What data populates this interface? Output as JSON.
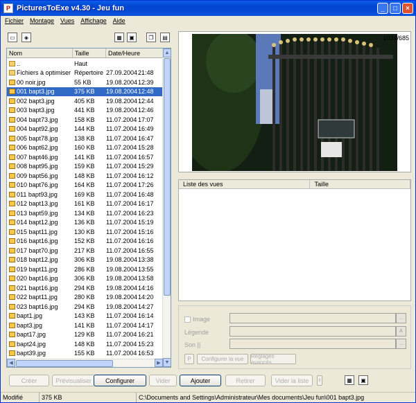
{
  "window": {
    "title": "PicturesToExe v4.30 - Jeu fun",
    "app_icon": "P"
  },
  "titlebar_buttons": {
    "minimize": "_",
    "maximize": "□",
    "close": "×"
  },
  "menu": [
    "Fichier",
    "Montage",
    "Vues",
    "Affichage",
    "Aide"
  ],
  "file_list": {
    "headers": [
      "Nom",
      "Taille",
      "Date/Heure"
    ],
    "rows": [
      {
        "name": "..",
        "size": "Haut",
        "date": "",
        "time": "",
        "type": "folder"
      },
      {
        "name": "Fichiers à optimiser",
        "size": "Répertoire",
        "date": "27.09.2004",
        "time": "21:48",
        "type": "folder"
      },
      {
        "name": "00 noir.jpg",
        "size": "55 KB",
        "date": "19.08.2004",
        "time": "12:39",
        "type": "file"
      },
      {
        "name": "001 bapt3.jpg",
        "size": "375 KB",
        "date": "19.08.2004",
        "time": "12:48",
        "type": "file",
        "selected": true
      },
      {
        "name": "002 bapt3.jpg",
        "size": "405 KB",
        "date": "19.08.2004",
        "time": "12:44",
        "type": "file"
      },
      {
        "name": "003 bapt3.jpg",
        "size": "441 KB",
        "date": "19.08.2004",
        "time": "12:46",
        "type": "file"
      },
      {
        "name": "004 bapt73.jpg",
        "size": "158 KB",
        "date": "11.07.2004",
        "time": "17:07",
        "type": "file"
      },
      {
        "name": "004 bapt92.jpg",
        "size": "144 KB",
        "date": "11.07.2004",
        "time": "16:49",
        "type": "file"
      },
      {
        "name": "005 bapt78.jpg",
        "size": "138 KB",
        "date": "11.07.2004",
        "time": "16:47",
        "type": "file"
      },
      {
        "name": "006 bapt62.jpg",
        "size": "160 KB",
        "date": "11.07.2004",
        "time": "15:28",
        "type": "file"
      },
      {
        "name": "007 bapt46.jpg",
        "size": "141 KB",
        "date": "11.07.2004",
        "time": "16:57",
        "type": "file"
      },
      {
        "name": "008 bapt95.jpg",
        "size": "159 KB",
        "date": "11.07.2004",
        "time": "15:29",
        "type": "file"
      },
      {
        "name": "009 bapt56.jpg",
        "size": "148 KB",
        "date": "11.07.2004",
        "time": "16:12",
        "type": "file"
      },
      {
        "name": "010 bapt76.jpg",
        "size": "164 KB",
        "date": "11.07.2004",
        "time": "17:26",
        "type": "file"
      },
      {
        "name": "011 bapt93.jpg",
        "size": "169 KB",
        "date": "11.07.2004",
        "time": "16:48",
        "type": "file"
      },
      {
        "name": "012 bapt13.jpg",
        "size": "161 KB",
        "date": "11.07.2004",
        "time": "16:17",
        "type": "file"
      },
      {
        "name": "013 bapt59.jpg",
        "size": "134 KB",
        "date": "11.07.2004",
        "time": "16:23",
        "type": "file"
      },
      {
        "name": "014 bapt12.jpg",
        "size": "136 KB",
        "date": "11.07.2004",
        "time": "15:19",
        "type": "file"
      },
      {
        "name": "015 bapt11.jpg",
        "size": "130 KB",
        "date": "11.07.2004",
        "time": "15:16",
        "type": "file"
      },
      {
        "name": "016 bapt16.jpg",
        "size": "152 KB",
        "date": "11.07.2004",
        "time": "16:16",
        "type": "file"
      },
      {
        "name": "017 bapt70.jpg",
        "size": "217 KB",
        "date": "11.07.2004",
        "time": "16:55",
        "type": "file"
      },
      {
        "name": "018 bapt12.jpg",
        "size": "306 KB",
        "date": "19.08.2004",
        "time": "13:38",
        "type": "file"
      },
      {
        "name": "019 bapt11.jpg",
        "size": "286 KB",
        "date": "19.08.2004",
        "time": "13:55",
        "type": "file"
      },
      {
        "name": "020 bapt16.jpg",
        "size": "306 KB",
        "date": "19.08.2004",
        "time": "13:58",
        "type": "file"
      },
      {
        "name": "021 bapt16.jpg",
        "size": "294 KB",
        "date": "19.08.2004",
        "time": "14:16",
        "type": "file"
      },
      {
        "name": "022 bapt11.jpg",
        "size": "280 KB",
        "date": "19.08.2004",
        "time": "14:20",
        "type": "file"
      },
      {
        "name": "023 bapt16.jpg",
        "size": "294 KB",
        "date": "19.08.2004",
        "time": "14:27",
        "type": "file"
      },
      {
        "name": "bapt1.jpg",
        "size": "143 KB",
        "date": "11.07.2004",
        "time": "16:14",
        "type": "file"
      },
      {
        "name": "bapt3.jpg",
        "size": "141 KB",
        "date": "11.07.2004",
        "time": "14:17",
        "type": "file"
      },
      {
        "name": "bapt17.jpg",
        "size": "129 KB",
        "date": "11.07.2004",
        "time": "16:21",
        "type": "file"
      },
      {
        "name": "bapt24.jpg",
        "size": "148 KB",
        "date": "11.07.2004",
        "time": "15:23",
        "type": "file"
      },
      {
        "name": "bapt39.jpg",
        "size": "155 KB",
        "date": "11.07.2004",
        "time": "16:53",
        "type": "file"
      }
    ]
  },
  "preview": {
    "resolution": "1024/685"
  },
  "views": {
    "headers": [
      "Liste des vues",
      "Taille"
    ]
  },
  "properties": {
    "image_label": "Image",
    "legend_label": "Légende",
    "sound_label": "Son ||",
    "button_p": "P",
    "configure_view": "Configurer la vue",
    "enhanced_settings": "Réglages avancés"
  },
  "bottom_buttons": {
    "create": "Créer",
    "preview": "Prévisualiser",
    "configure": "Configurer",
    "empty": "Vider",
    "add": "Ajouter",
    "remove": "Retirer",
    "empty_list": "Vider la liste"
  },
  "status": {
    "state": "Modifié",
    "size": "375 KB",
    "path": "C:\\Documents and Settings\\Administrateur\\Mes documents\\Jeu fun\\001 bapt3.jpg"
  }
}
